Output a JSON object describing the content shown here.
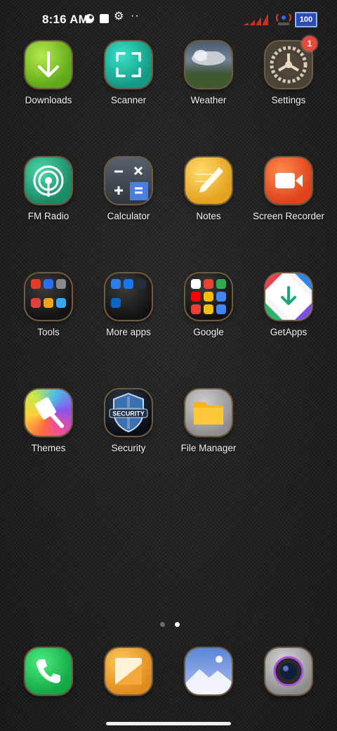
{
  "status_bar": {
    "time": "8:16 AM",
    "battery": "100",
    "icons": [
      "data-saver-icon",
      "notification-square-icon",
      "gear-icon",
      "more-dots-icon",
      "signal-bars-icon",
      "hotspot-icon",
      "battery-icon"
    ]
  },
  "apps": {
    "downloads": {
      "label": "Downloads",
      "icon": "download-arrow-icon"
    },
    "scanner": {
      "label": "Scanner",
      "icon": "scan-frame-icon"
    },
    "weather": {
      "label": "Weather",
      "icon": "cloud-icon"
    },
    "settings": {
      "label": "Settings",
      "icon": "gear-icon",
      "badge": "1"
    },
    "fm_radio": {
      "label": "FM Radio",
      "icon": "radio-icon"
    },
    "calculator": {
      "label": "Calculator",
      "icon": "calculator-icon"
    },
    "notes": {
      "label": "Notes",
      "icon": "pencil-icon"
    },
    "screen_recorder": {
      "label": "Screen Recorder",
      "icon": "video-camera-icon"
    },
    "tools": {
      "label": "Tools",
      "icon": "folder-icon"
    },
    "more_apps": {
      "label": "More apps",
      "icon": "folder-icon"
    },
    "google": {
      "label": "Google",
      "icon": "folder-icon"
    },
    "getapps": {
      "label": "GetApps",
      "icon": "getapps-icon"
    },
    "themes": {
      "label": "Themes",
      "icon": "paintbrush-icon"
    },
    "security": {
      "label": "Security",
      "icon": "shield-icon",
      "text": "SECURITY"
    },
    "file_manager": {
      "label": "File Manager",
      "icon": "folder-icon"
    }
  },
  "dock": {
    "phone": {
      "icon": "phone-icon"
    },
    "gallery": {
      "icon": "gallery-icon"
    },
    "photos": {
      "icon": "mountain-photo-icon"
    },
    "camera": {
      "icon": "camera-lens-icon"
    }
  },
  "pagination": {
    "pages": 2,
    "current": 2
  },
  "colors": {
    "badge": "#e64a3c",
    "label": "#f2f2f2"
  }
}
